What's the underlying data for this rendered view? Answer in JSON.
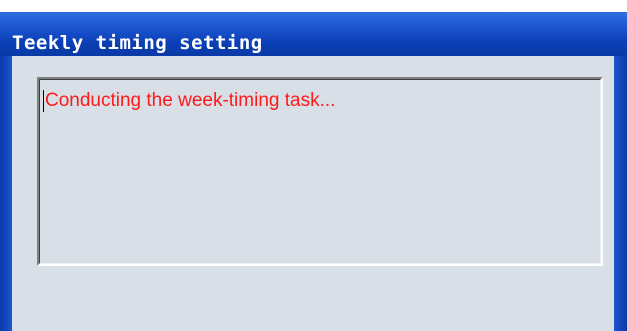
{
  "window": {
    "title": "Teekly timing setting"
  },
  "status": {
    "message": "Conducting the week-timing task..."
  },
  "colors": {
    "titlebar": "#1c55d0",
    "client_background": "#d8dfe7",
    "message_text": "#ff1a1a"
  }
}
